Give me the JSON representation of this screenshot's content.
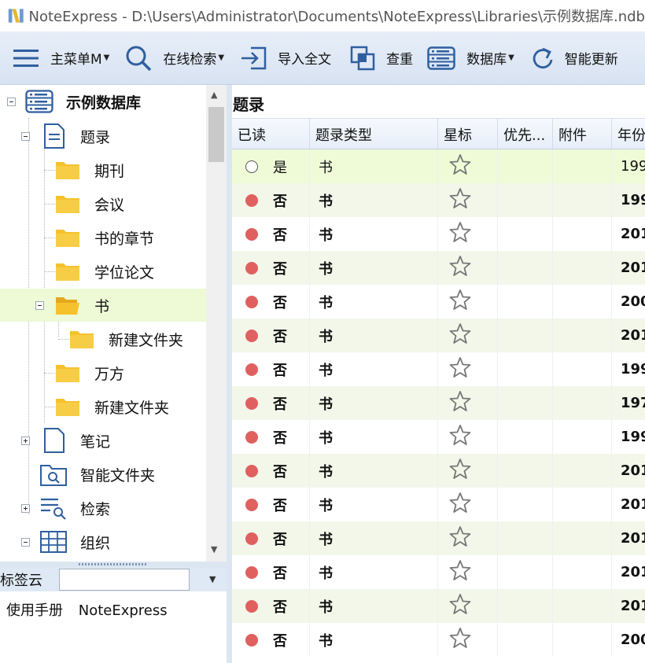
{
  "window": {
    "title": "NoteExpress - D:\\Users\\Administrator\\Documents\\NoteExpress\\Libraries\\示例数据库.ndb"
  },
  "toolbar": {
    "main_menu": "主菜单M",
    "online_search": "在线检索",
    "import_fulltext": "导入全文",
    "dedupe": "查重",
    "database": "数据库",
    "smart_update": "智能更新"
  },
  "tree": {
    "root": "示例数据库",
    "items": [
      {
        "label": "题录"
      },
      {
        "label": "期刊"
      },
      {
        "label": "会议"
      },
      {
        "label": "书的章节"
      },
      {
        "label": "学位论文"
      },
      {
        "label": "书"
      },
      {
        "label": "新建文件夹"
      },
      {
        "label": "万方"
      },
      {
        "label": "新建文件夹"
      },
      {
        "label": "笔记"
      },
      {
        "label": "智能文件夹"
      },
      {
        "label": "检索"
      },
      {
        "label": "组织"
      }
    ]
  },
  "tagcloud": {
    "label": "标签云",
    "input_value": "",
    "tags": [
      "使用手册",
      "NoteExpress"
    ]
  },
  "grid": {
    "title": "题录",
    "columns": [
      "已读",
      "题录类型",
      "星标",
      "优先...",
      "附件",
      "年份"
    ],
    "rows": [
      {
        "read": "是",
        "type": "书",
        "year": "199"
      },
      {
        "read": "否",
        "type": "书",
        "year": "199"
      },
      {
        "read": "否",
        "type": "书",
        "year": "201"
      },
      {
        "read": "否",
        "type": "书",
        "year": "201"
      },
      {
        "read": "否",
        "type": "书",
        "year": "200"
      },
      {
        "read": "否",
        "type": "书",
        "year": "201"
      },
      {
        "read": "否",
        "type": "书",
        "year": "199"
      },
      {
        "read": "否",
        "type": "书",
        "year": "197"
      },
      {
        "read": "否",
        "type": "书",
        "year": "199"
      },
      {
        "read": "否",
        "type": "书",
        "year": "201"
      },
      {
        "read": "否",
        "type": "书",
        "year": "201"
      },
      {
        "read": "否",
        "type": "书",
        "year": "201"
      },
      {
        "read": "否",
        "type": "书",
        "year": "201"
      },
      {
        "read": "否",
        "type": "书",
        "year": "201"
      },
      {
        "read": "否",
        "type": "书",
        "year": "200"
      }
    ]
  },
  "colors": {
    "accent": "#3f6fb0",
    "unread_dot": "#e06060",
    "selected_row": "#eefbd6",
    "folder": "#f5c22e"
  },
  "icons": [
    "app-logo-icon",
    "menu-icon",
    "search-icon",
    "import-icon",
    "dedupe-icon",
    "database-icon",
    "refresh-icon",
    "folder-icon",
    "document-icon",
    "smart-folder-icon",
    "search-list-icon",
    "grid-icon",
    "star-icon"
  ]
}
